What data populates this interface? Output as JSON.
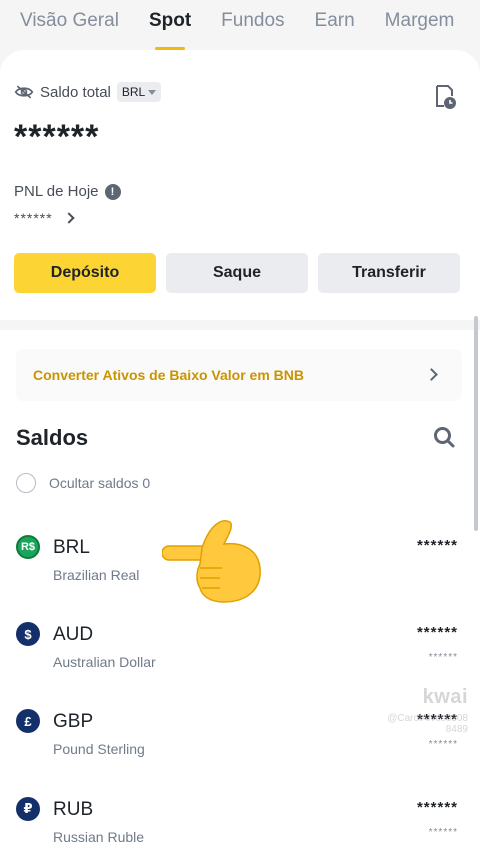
{
  "tabs": [
    "Visão Geral",
    "Spot",
    "Fundos",
    "Earn",
    "Margem"
  ],
  "active_tab": "Spot",
  "balance": {
    "label": "Saldo total",
    "currency": "BRL",
    "value": "******",
    "icons": {
      "hide": "eye-slash-icon",
      "history": "history-icon"
    }
  },
  "pnl": {
    "label": "PNL de Hoje",
    "info_glyph": "!",
    "value": "******"
  },
  "buttons": {
    "deposit": "Depósito",
    "withdraw": "Saque",
    "transfer": "Transferir"
  },
  "convert_banner": "Converter Ativos de Baixo Valor em BNB",
  "saldos": {
    "title": "Saldos",
    "hide_label": "Ocultar saldos 0"
  },
  "assets": [
    {
      "symbol": "BRL",
      "name": "Brazilian Real",
      "balance": "******",
      "fiat": "",
      "icon_glyph": "R$",
      "icon_color": "#1aa65a"
    },
    {
      "symbol": "AUD",
      "name": "Australian Dollar",
      "balance": "******",
      "fiat": "******",
      "icon_glyph": "$",
      "icon_color": "#14306b"
    },
    {
      "symbol": "GBP",
      "name": "Pound Sterling",
      "balance": "******",
      "fiat": "******",
      "icon_glyph": "£",
      "icon_color": "#14306b"
    },
    {
      "symbol": "RUB",
      "name": "Russian Ruble",
      "balance": "******",
      "fiat": "******",
      "icon_glyph": "₽",
      "icon_color": "#14306b"
    }
  ],
  "watermark": {
    "logo": "kwai",
    "user": "@CarolAlves0308",
    "id": "8489"
  },
  "colors": {
    "accent": "#fcd535",
    "accent_text": "#c99400",
    "text_primary": "#1e2329",
    "text_secondary": "#707a8a"
  }
}
